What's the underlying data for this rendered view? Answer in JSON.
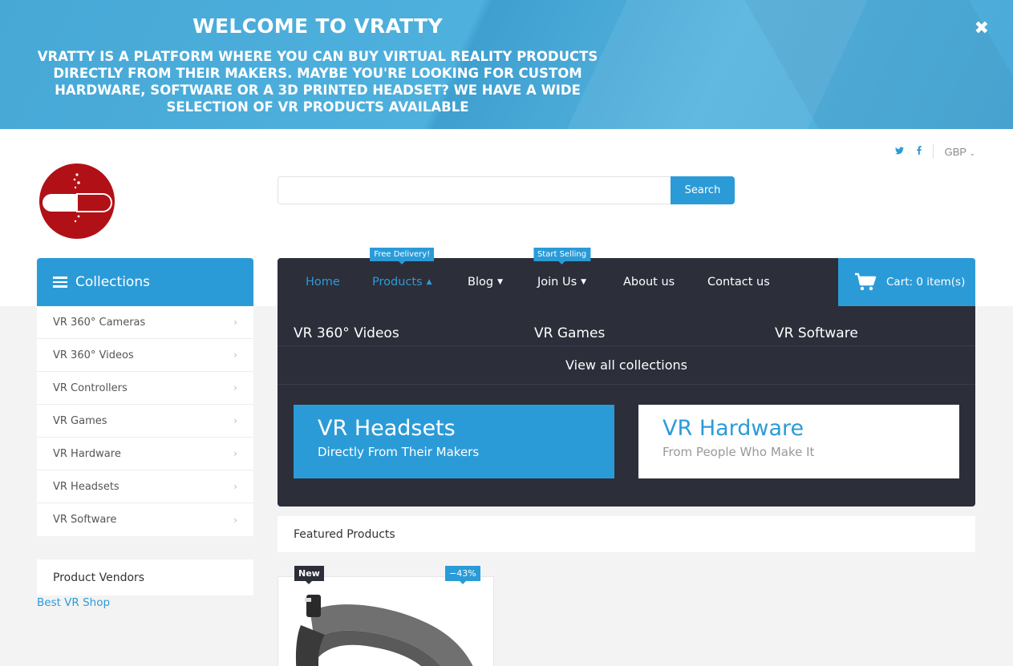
{
  "banner": {
    "title": "WELCOME TO VRATTY",
    "text": "VRATTY IS A PLATFORM WHERE YOU CAN BUY VIRTUAL REALITY PRODUCTS DIRECTLY FROM THEIR MAKERS. MAYBE YOU'RE LOOKING FOR CUSTOM HARDWARE, SOFTWARE OR A 3D PRINTED HEADSET? WE HAVE A WIDE SELECTION OF VR PRODUCTS AVAILABLE",
    "close_icon": "close-icon"
  },
  "topbar": {
    "twitter": "t",
    "facebook": "f",
    "currency": "GBP"
  },
  "search": {
    "placeholder": "",
    "button": "Search"
  },
  "sidebar": {
    "title": "Collections",
    "items": [
      {
        "label": "VR 360° Cameras"
      },
      {
        "label": "VR 360° Videos"
      },
      {
        "label": "VR Controllers"
      },
      {
        "label": "VR Games"
      },
      {
        "label": "VR Hardware"
      },
      {
        "label": "VR Headsets"
      },
      {
        "label": "VR Software"
      }
    ],
    "vendors_title": "Product Vendors",
    "vendor_link": "Best VR Shop"
  },
  "nav": {
    "home": "Home",
    "products": "Products",
    "products_badge": "Free Delivery!",
    "blog": "Blog",
    "join": "Join Us",
    "join_badge": "Start Selling",
    "about": "About us",
    "contact": "Contact us",
    "cart": "Cart: 0 item(s)"
  },
  "dropdown": {
    "col1": "VR 360° Videos",
    "col2": "VR Games",
    "col3": "VR Software",
    "view_all": "View all collections",
    "promo1_title": "VR Headsets",
    "promo1_sub": "Directly From Their Makers",
    "promo2_title": "VR Hardware",
    "promo2_sub": "From People Who Make It"
  },
  "featured": {
    "title": "Featured Products",
    "badge_new": "New",
    "badge_sale": "−43%"
  },
  "colors": {
    "accent": "#2b9bd8",
    "nav_dark": "#2c2e3a",
    "logo_red": "#b11116"
  }
}
